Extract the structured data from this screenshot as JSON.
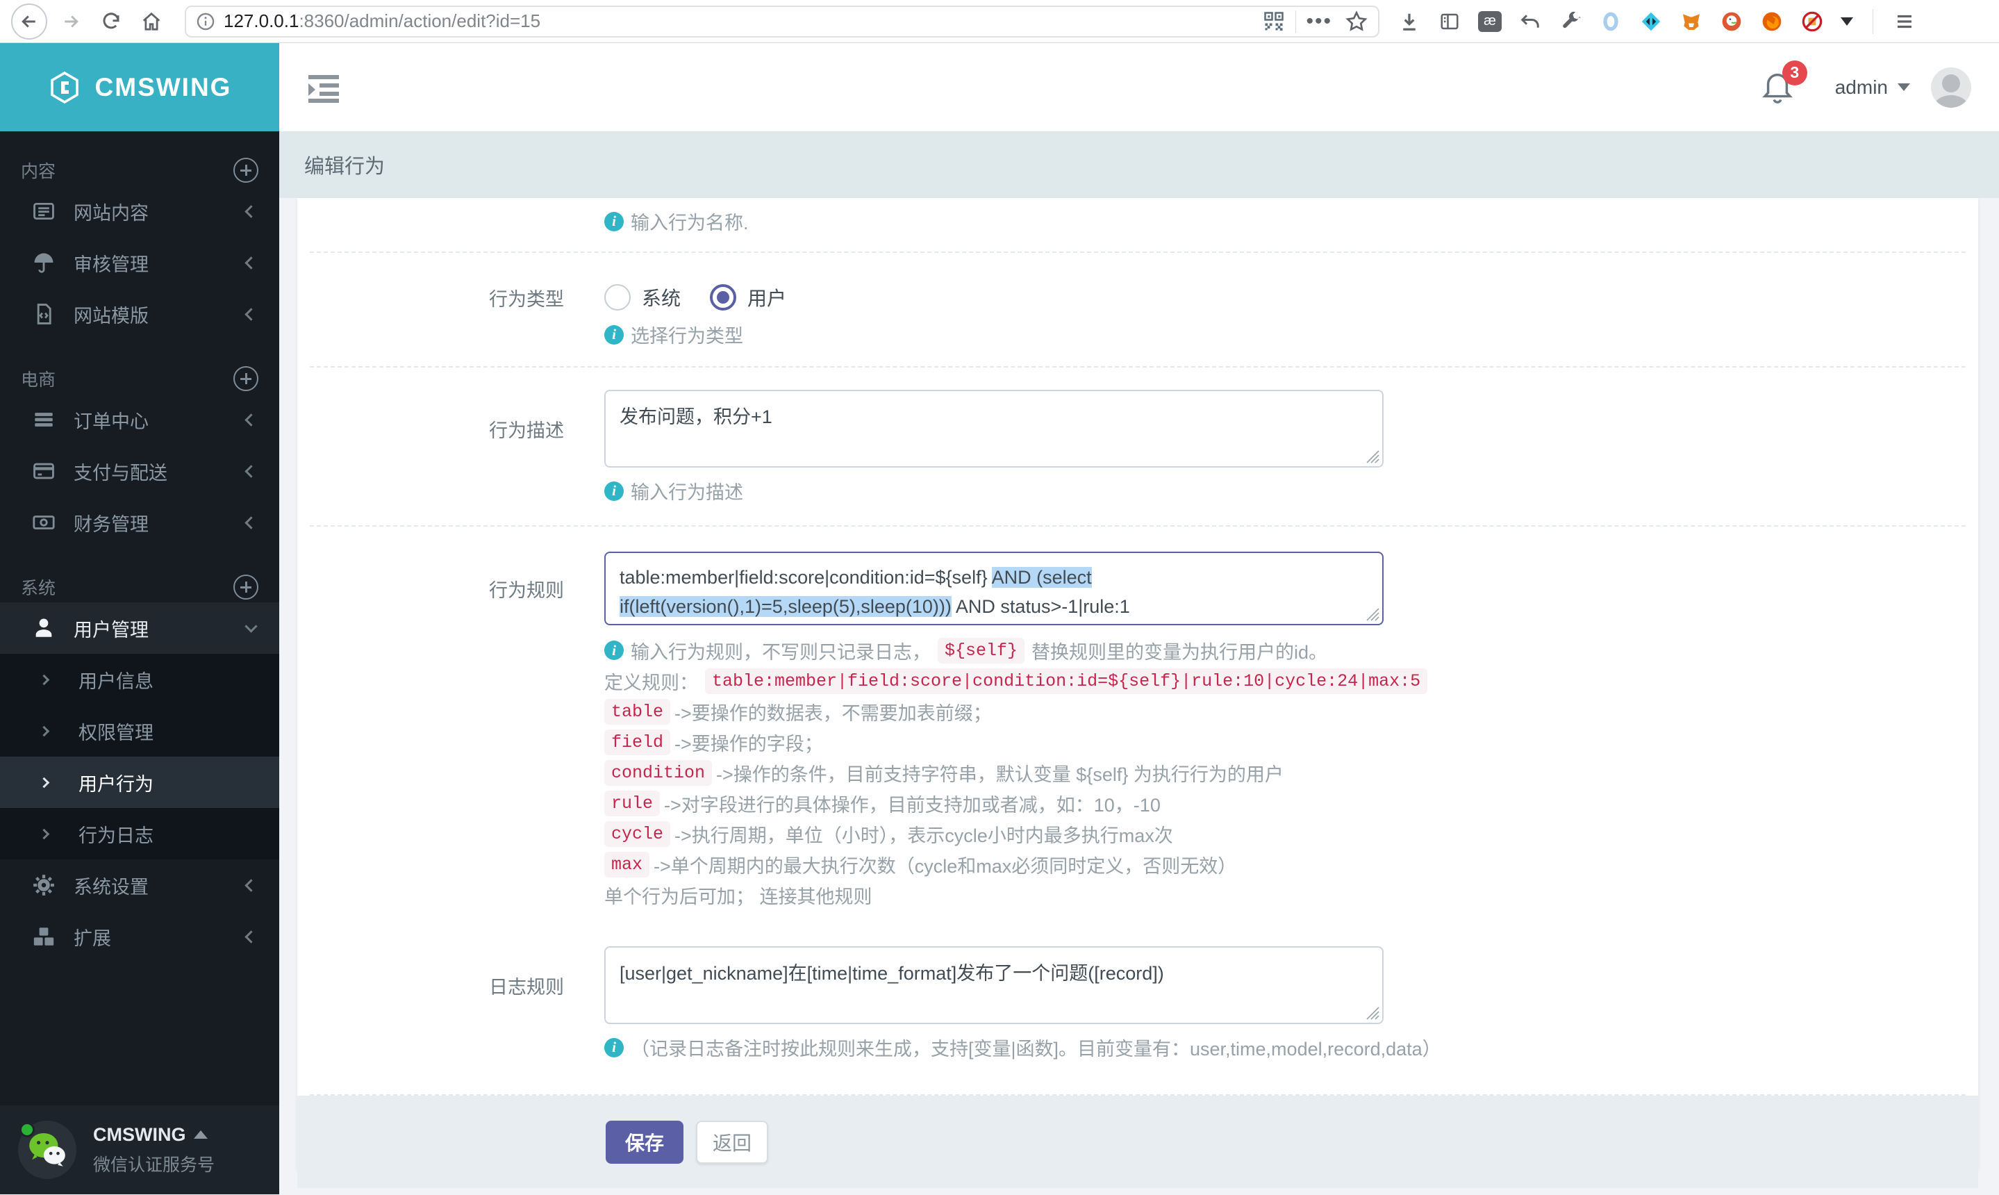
{
  "browser": {
    "url_host": "127.0.0.1",
    "url_rest": ":8360/admin/action/edit?id=15"
  },
  "brand": {
    "name": "CMSWING"
  },
  "sidebar": {
    "sections": [
      {
        "label": "内容",
        "items": [
          {
            "label": "网站内容"
          },
          {
            "label": "审核管理"
          },
          {
            "label": "网站模版"
          }
        ]
      },
      {
        "label": "电商",
        "items": [
          {
            "label": "订单中心"
          },
          {
            "label": "支付与配送"
          },
          {
            "label": "财务管理"
          }
        ]
      },
      {
        "label": "系统",
        "items": [
          {
            "label": "用户管理",
            "children": [
              {
                "label": "用户信息"
              },
              {
                "label": "权限管理"
              },
              {
                "label": "用户行为"
              },
              {
                "label": "行为日志"
              }
            ]
          },
          {
            "label": "系统设置"
          },
          {
            "label": "扩展"
          }
        ]
      }
    ],
    "user": {
      "name": "CMSWING",
      "desc": "微信认证服务号"
    }
  },
  "header": {
    "username": "admin",
    "notification_count": "3"
  },
  "page": {
    "title": "编辑行为"
  },
  "form": {
    "name_help": "输入行为名称.",
    "type": {
      "label": "行为类型",
      "option_system": "系统",
      "option_user": "用户",
      "selected": "用户",
      "help": "选择行为类型"
    },
    "desc": {
      "label": "行为描述",
      "value": "发布问题，积分+1",
      "help": "输入行为描述"
    },
    "rule": {
      "label": "行为规则",
      "line1_pre": "table:member|field:score|condition:id=${self} ",
      "line1_sel": "AND (select",
      "line2_sel": "if(left(version(),1)=5,sleep(5),sleep(10)))",
      "line2_post": " AND status>-1|rule:1",
      "help1_pre": "输入行为规则，不写则只记录日志，",
      "help1_code": "${self}",
      "help1_post": "替换规则里的变量为执行用户的id。",
      "help2_pre": "定义规则：",
      "help2_code": "table:member|field:score|condition:id=${self}|rule:10|cycle:24|max:5",
      "params": [
        {
          "code": "table",
          "text": "->要操作的数据表，不需要加表前缀；"
        },
        {
          "code": "field",
          "text": "->要操作的字段；"
        },
        {
          "code": "condition",
          "text": "->操作的条件，目前支持字符串，默认变量 ${self} 为执行行为的用户"
        },
        {
          "code": "rule",
          "text": "->对字段进行的具体操作，目前支持加或者减，如：10，-10"
        },
        {
          "code": "cycle",
          "text": "->执行周期，单位（小时），表示cycle小时内最多执行max次"
        },
        {
          "code": "max",
          "text": "->单个周期内的最大执行次数（cycle和max必须同时定义，否则无效）"
        }
      ],
      "tail": "单个行为后可加； 连接其他规则"
    },
    "log": {
      "label": "日志规则",
      "value": "[user|get_nickname]在[time|time_format]发布了一个问题([record])",
      "help": "（记录日志备注时按此规则来生成，支持[变量|函数]。目前变量有：user,time,model,record,data）"
    },
    "save_label": "保存",
    "back_label": "返回"
  },
  "colors": {
    "accent": "#5b5fa6",
    "teal": "#38b1c5",
    "badge": "#e5494f",
    "code": "#c7254e",
    "selection": "#b5d8f6"
  }
}
